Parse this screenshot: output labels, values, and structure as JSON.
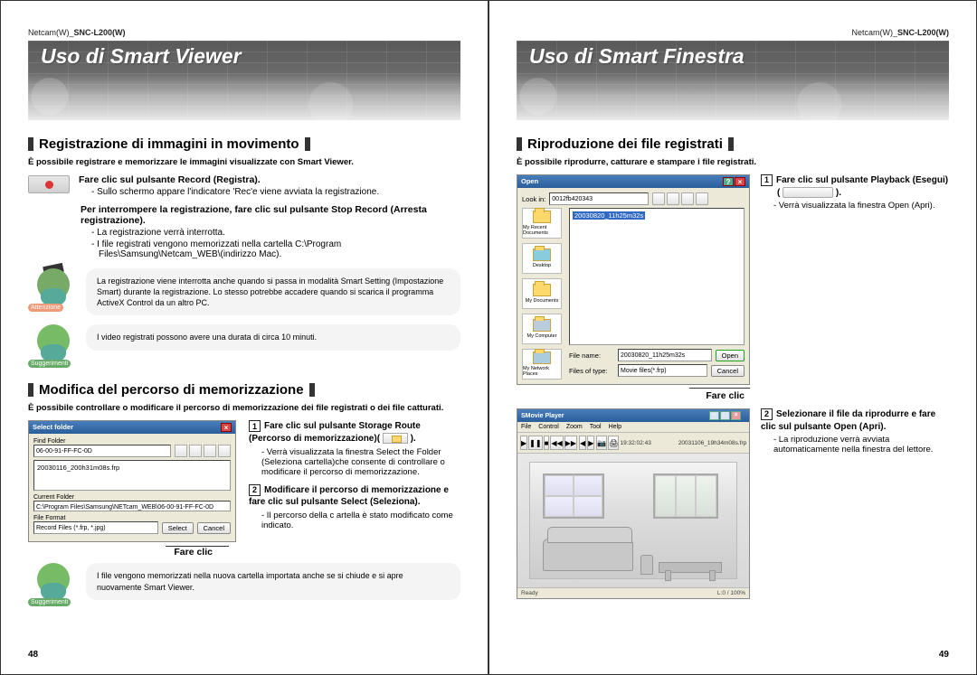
{
  "header_model": {
    "prefix": "Netcam(W)_",
    "model": "SNC-L200(W)"
  },
  "left": {
    "banner": "Uso di Smart Viewer",
    "sec1": {
      "title": "Registrazione di immagini in movimento",
      "intro": "È possibile registrare e memorizzare le immagini visualizzate con Smart Viewer.",
      "rec_head": "Fare clic sul pulsante Record (Registra).",
      "rec_sub": "- Sullo schermo appare l'indicatore 'Rec'e viene avviata la registrazione.",
      "stop_head": "Per interrompere la registrazione, fare clic sul pulsante Stop Record (Arresta registrazione).",
      "stop_d1": "- La registrazione verrà interrotta.",
      "stop_d2": "- I file registrati vengono memorizzati nella cartella C:\\Program Files\\Samsung\\Netcam_WEB\\(indirizzo Mac).",
      "attn_tag": "Attenzione",
      "attn_text": "La registrazione viene interrotta anche quando si passa in modalità Smart Setting (Impostazione Smart) durante la registrazione. Lo stesso potrebbe accadere quando si scarica il programma ActiveX Control da un altro PC.",
      "sugg_tag": "Suggerimenti",
      "sugg_text": "I video registrati possono avere una durata di circa 10 minuti."
    },
    "sec2": {
      "title": "Modifica del percorso di memorizzazione",
      "intro": "È possibile controllare o modificare il percorso di memorizzazione dei file registrati o dei file catturati.",
      "dlg": {
        "title": "Select folder",
        "find_label": "Find Folder",
        "find_value": "06-00-91-FF-FC-0D",
        "tree_item": "20030116_200h31m08s.frp",
        "cur_label": "Current Folder",
        "cur_value": "C:\\Program Files\\Samsung\\NETcam_WEB\\06-00-91-FF-FC-0D",
        "file_label": "File Format",
        "file_value": "Record Files (*.frp, *.jpg)",
        "select": "Select",
        "cancel": "Cancel"
      },
      "callout": "Fare clic",
      "step1_head": "Fare clic sul pulsante Storage Route (Percorso di memorizzazione)(",
      "step1_tail": ").",
      "step1_sub": "- Verrà visualizzata la finestra Select the Folder (Seleziona cartella)che consente di controllare o modificare il percorso di memorizzazione.",
      "step2_head": "Modificare il percorso di memorizzazione e fare clic sul pulsante Select (Seleziona).",
      "step2_sub": "- Il percorso della c artella è stato modificato come indicato.",
      "sugg2_text": "I file vengono memorizzati nella nuova cartella importata anche se si chiude e si apre nuovamente Smart Viewer."
    },
    "page_no": "48"
  },
  "right": {
    "banner": "Uso di Smart Finestra",
    "sec1": {
      "title": "Riproduzione dei file registrati",
      "intro": "È possibile riprodurre, catturare e stampare i file registrati.",
      "open_dlg": {
        "title": "Open",
        "lookin": "Look in:",
        "lookin_val": "0012fb420343",
        "folders": [
          "My Recent Documents",
          "Desktop",
          "My Documents",
          "My Computer",
          "My Network Places"
        ],
        "file_item": "20030820_11h25m32s",
        "fname_label": "File name:",
        "fname_val": "20030820_11h25m32s",
        "ftype_label": "Files of type:",
        "ftype_val": "Movie files(*.frp)",
        "open_btn": "Open",
        "cancel_btn": "Cancel"
      },
      "fare_clic": "Fare clic",
      "step1_head": "Fare clic sul pulsante Playback (Esegui)",
      "step1_paren_open": "(",
      "step1_paren_close": ").",
      "step1_sub": "- Verrà visualizzata la finestra Open (Apri).",
      "player": {
        "title": "SMovie Player",
        "menu": [
          "File",
          "Control",
          "Zoom",
          "Tool",
          "Help"
        ],
        "readout_a": "19:32:02:43",
        "readout_b": "20031106_19h34m08s.frp",
        "status_left": "Ready",
        "status_right": "L:0 / 100%"
      },
      "step2_head": "Selezionare il file da riprodurre e fare clic sul pulsante Open (Apri).",
      "step2_sub": "- La riproduzione verrà avviata automaticamente nella finestra del lettore."
    },
    "page_no": "49"
  }
}
